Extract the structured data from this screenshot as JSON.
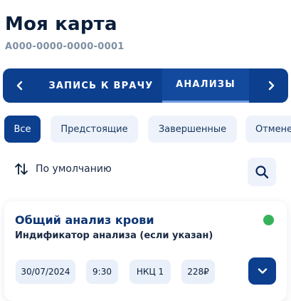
{
  "header": {
    "title": "Моя карта",
    "card_number": "A000-0000-0000-0001"
  },
  "tabs": {
    "prev_icon": "chevron-left-icon",
    "next_icon": "chevron-right-icon",
    "items": [
      {
        "label": "ЗАПИСЬ К ВРАЧУ",
        "active": false
      },
      {
        "label": "АНАЛИЗЫ",
        "active": true
      }
    ]
  },
  "filters": [
    {
      "label": "Все",
      "active": true
    },
    {
      "label": "Предстоящие",
      "active": false
    },
    {
      "label": "Завершенные",
      "active": false
    },
    {
      "label": "Отмене",
      "active": false
    }
  ],
  "sort": {
    "icon": "sort-icon",
    "label": "По умолчанию"
  },
  "search": {
    "icon": "search-icon"
  },
  "analysis_card": {
    "title": "Общий анализ крови",
    "subtitle": "Индификатор анализа (если указан)",
    "status_color": "#36b35a",
    "date": "30/07/2024",
    "time": "9:30",
    "location": "НКЦ 1",
    "price": "228₽",
    "expand_icon": "chevron-down-icon"
  },
  "colors": {
    "primary": "#0d3f8f",
    "chip_bg": "#e9f0fa",
    "status_ok": "#36b35a"
  }
}
